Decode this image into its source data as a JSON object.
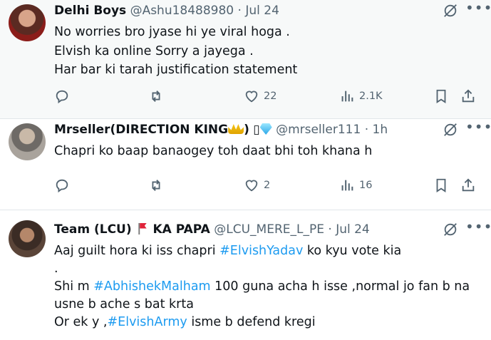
{
  "tweets": [
    {
      "name": "Delhi Boys",
      "handle": "@Ashu18488980",
      "sep": "·",
      "time": "Jul 24",
      "lines": [
        "No worries bro jyase hi ye viral hoga .",
        "Elvish ka online Sorry a jayega .",
        "Har bar ki tarah justification statement"
      ],
      "reply_count": "",
      "retweet_count": "",
      "like_count": "22",
      "view_count": "2.1K"
    },
    {
      "name_prefix": "Mrseller(DIRECTION KING",
      "name_suffix": ")",
      "name_glyph": "▯",
      "handle": "@mrseller111",
      "sep": "·",
      "time": "1h",
      "lines": [
        "Chapri ko baap banaogey toh daat bhi toh khana h"
      ],
      "like_count": "2",
      "view_count": "16"
    },
    {
      "name_prefix": "Team (LCU)",
      "name_suffix": "KA PAPA",
      "handle": "@LCU_MERE_L_PE",
      "sep": "·",
      "time": "Jul 24",
      "l1_pre": "Aaj guilt hora ki iss chapri ",
      "l1_tag": "#ElvishYadav",
      "l1_post": " ko kyu vote kia",
      "l2": ".",
      "l3_pre": "Shi m ",
      "l3_tag": "#AbhishekMalham",
      "l3_post": " 100 guna acha h isse ,normal jo fan b na",
      "l4": "usne b  ache s bat krta",
      "l5_pre": "Or ek y ,",
      "l5_tag": "#ElvishArmy",
      "l5_post": " isme b defend kregi"
    }
  ],
  "icons": [
    "grok-icon",
    "more-icon",
    "reply-icon",
    "retweet-icon",
    "like-icon",
    "views-icon",
    "bookmark-icon",
    "share-icon"
  ],
  "colors": {
    "link": "#1d9bf0",
    "muted": "#536471",
    "flag": "#e0243a"
  }
}
